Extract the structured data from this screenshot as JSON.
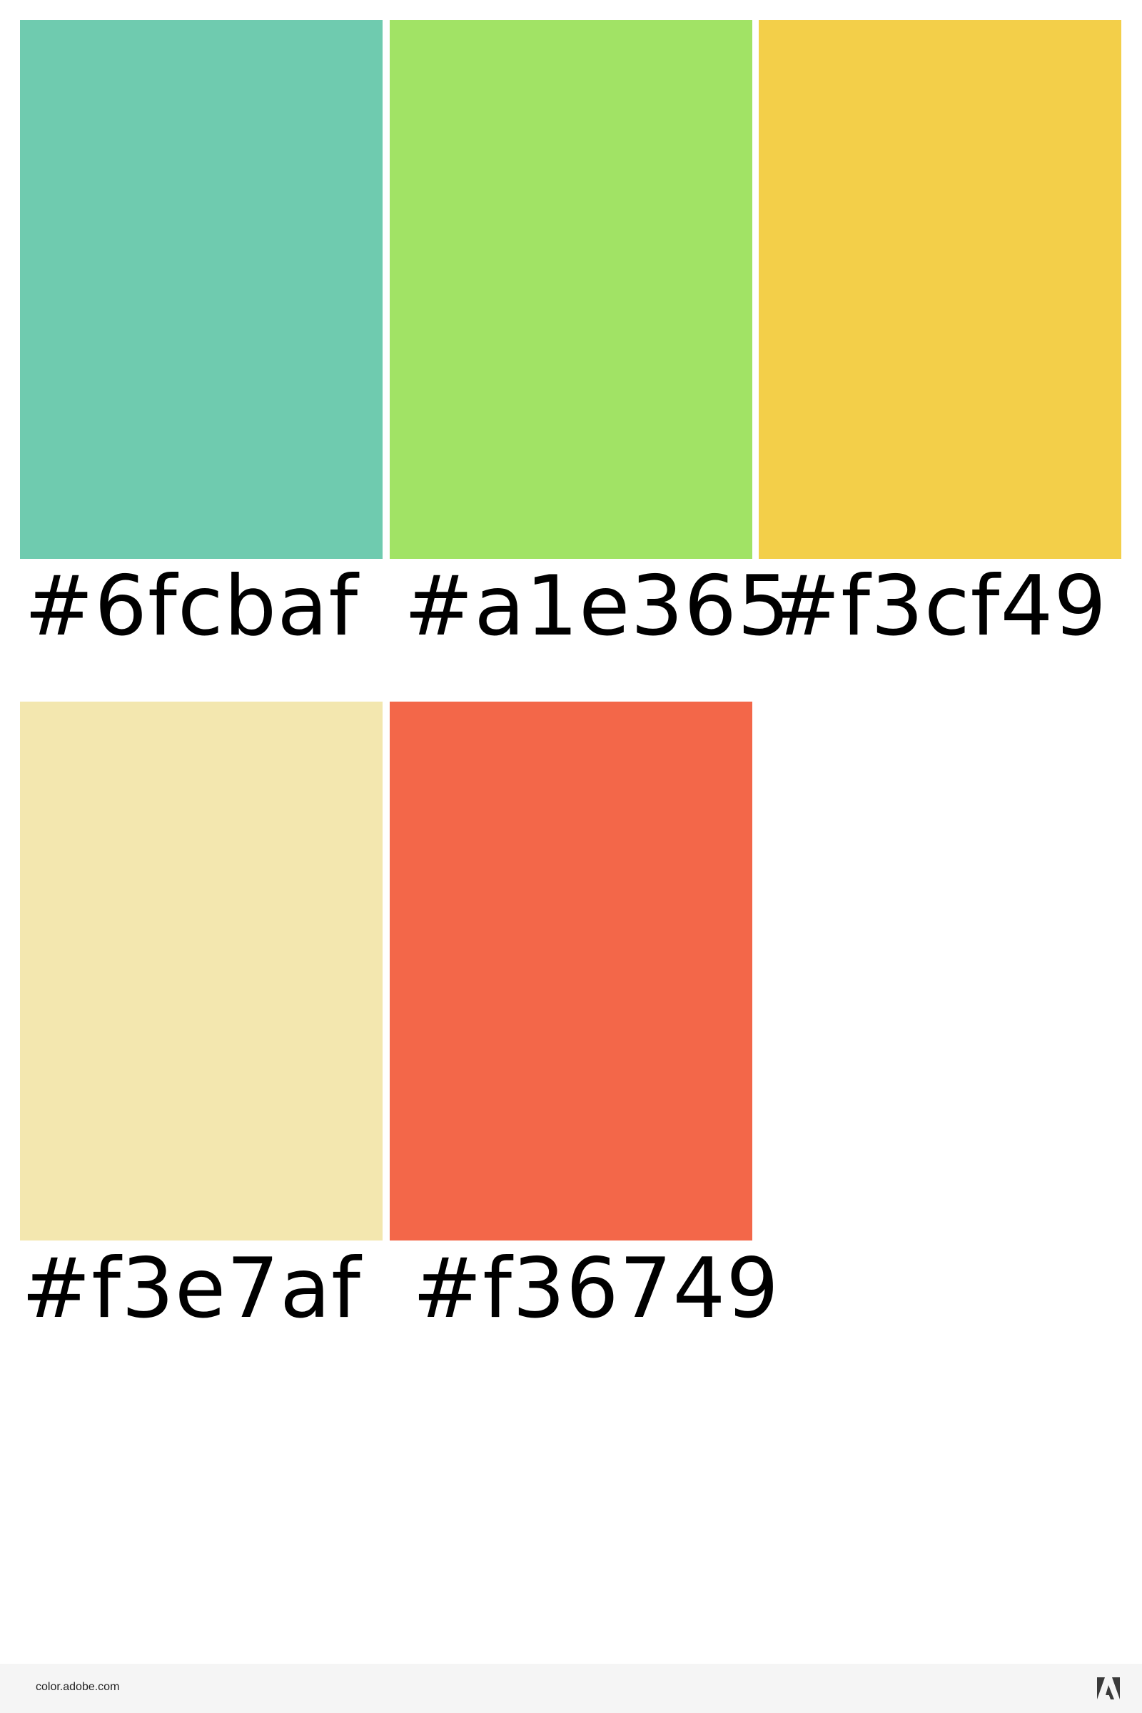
{
  "palette": {
    "swatches": [
      {
        "color": "#6fcbaf",
        "label": "#6fcbaf"
      },
      {
        "color": "#a1e365",
        "label": "#a1e365"
      },
      {
        "color": "#f3cf49",
        "label": "#f3cf49"
      },
      {
        "color": "#f3e7af",
        "label": "#f3e7af"
      },
      {
        "color": "#f36749",
        "label": "#f36749"
      }
    ]
  },
  "footer": {
    "site": "color.adobe.com",
    "logo_icon": "adobe-logo-icon",
    "background": "#f5f5f5"
  }
}
